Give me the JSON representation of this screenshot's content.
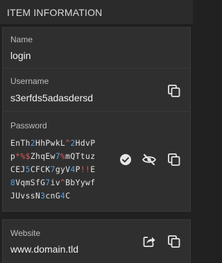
{
  "header": {
    "title": "ITEM INFORMATION"
  },
  "fields": {
    "name": {
      "label": "Name",
      "value": "login"
    },
    "username": {
      "label": "Username",
      "value": "s3erfds5adasdersd"
    },
    "password": {
      "label": "Password",
      "lines": [
        [
          [
            "t",
            "EnTh"
          ],
          [
            "d",
            "2"
          ],
          [
            "t",
            "HhPwkL"
          ],
          [
            "s",
            "^"
          ],
          [
            "d",
            "2"
          ],
          [
            "t",
            "HdvP"
          ]
        ],
        [
          [
            "t",
            "p"
          ],
          [
            "s",
            "*%$"
          ],
          [
            "t",
            "ZhqEw"
          ],
          [
            "d",
            "7"
          ],
          [
            "s",
            "%"
          ],
          [
            "t",
            "mQTtuz"
          ]
        ],
        [
          [
            "t",
            "CEJ"
          ],
          [
            "d",
            "5"
          ],
          [
            "t",
            "CFCK"
          ],
          [
            "d",
            "7"
          ],
          [
            "t",
            "gyV"
          ],
          [
            "d",
            "4"
          ],
          [
            "t",
            "P"
          ],
          [
            "s",
            "!!"
          ],
          [
            "t",
            "E"
          ]
        ],
        [
          [
            "d",
            "8"
          ],
          [
            "t",
            "VqmSfG"
          ],
          [
            "d",
            "7"
          ],
          [
            "t",
            "iv"
          ],
          [
            "s",
            "^"
          ],
          [
            "t",
            "BbYywf"
          ]
        ],
        [
          [
            "t",
            "JUvssN"
          ],
          [
            "d",
            "3"
          ],
          [
            "t",
            "cnG"
          ],
          [
            "d",
            "4"
          ],
          [
            "t",
            "C"
          ]
        ]
      ]
    },
    "website": {
      "label": "Website",
      "value": "www.domain.tld"
    }
  },
  "icons": {
    "copy": "copy-icon",
    "check": "check-circle-icon",
    "eye": "eye-slash-icon",
    "launch": "launch-icon"
  }
}
